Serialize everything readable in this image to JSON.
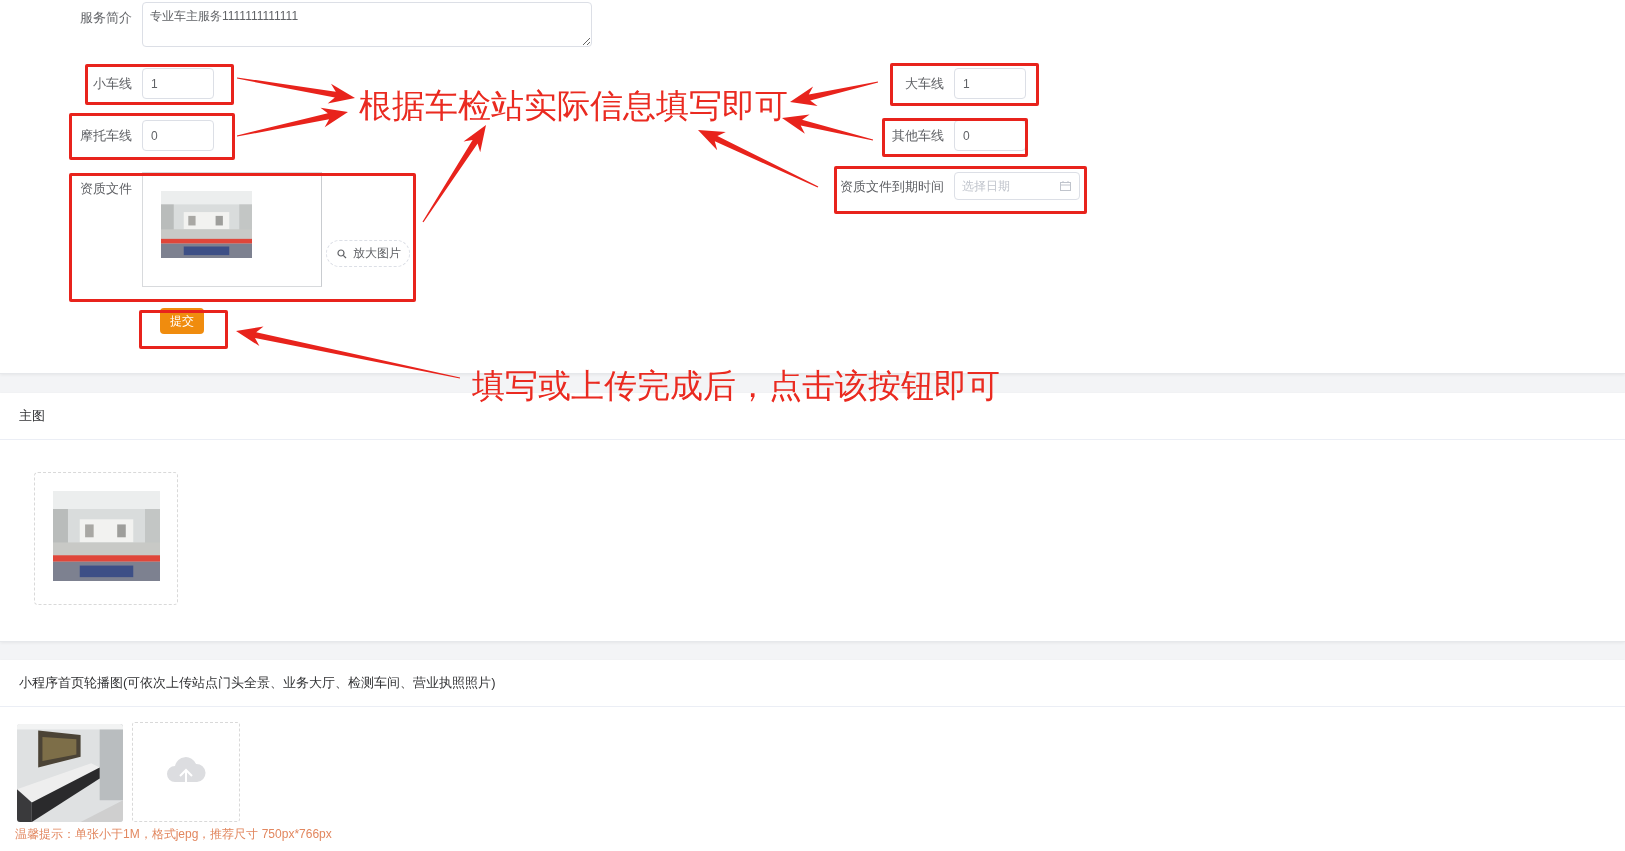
{
  "form": {
    "intro": {
      "label": "服务简介",
      "value": "专业车主服务1111111111111"
    },
    "left_fields": [
      {
        "label": "小车线",
        "value": "1"
      },
      {
        "label": "摩托车线",
        "value": "0"
      }
    ],
    "right_fields": [
      {
        "label": "大车线",
        "value": "1"
      },
      {
        "label": "其他车线",
        "value": "0"
      }
    ],
    "qualification": {
      "label": "资质文件",
      "zoom_button": "放大图片"
    },
    "expiry": {
      "label": "资质文件到期时间",
      "placeholder": "选择日期"
    },
    "submit": "提交"
  },
  "main_image": {
    "title": "主图"
  },
  "carousel": {
    "title": "小程序首页轮播图(可依次上传站点门头全景、业务大厅、检测车间、营业执照照片)",
    "hint": "温馨提示：单张小于1M，格式jepg，推荐尺寸 750px*766px"
  },
  "annotations": [
    "根据车检站实际信息填写即可",
    "填写或上传完成后，点击该按钮即可"
  ]
}
